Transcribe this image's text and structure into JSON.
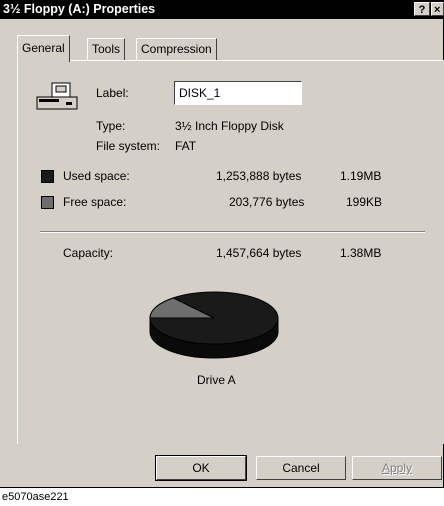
{
  "window": {
    "title": "3½ Floppy (A:) Properties",
    "help_button": "?",
    "close_button": "×"
  },
  "tabs": [
    {
      "label": "General",
      "active": true
    },
    {
      "label": "Tools",
      "active": false
    },
    {
      "label": "Compression",
      "active": false
    }
  ],
  "general": {
    "label_caption": "Label:",
    "label_value": "DISK_1",
    "type_caption": "Type:",
    "type_value": "3½ Inch Floppy Disk",
    "fs_caption": "File system:",
    "fs_value": "FAT",
    "used": {
      "caption": "Used space:",
      "bytes": "1,253,888 bytes",
      "size": "1.19MB",
      "color": "#1a1a1a"
    },
    "free": {
      "caption": "Free space:",
      "bytes": "203,776 bytes",
      "size": "199KB",
      "color": "#6e6e6e"
    },
    "capacity": {
      "caption": "Capacity:",
      "bytes": "1,457,664 bytes",
      "size": "1.38MB"
    },
    "drive_label": "Drive A",
    "used_fraction": 0.86
  },
  "buttons": {
    "ok": "OK",
    "cancel": "Cancel",
    "apply": "Apply"
  },
  "caption": "e5070ase221"
}
